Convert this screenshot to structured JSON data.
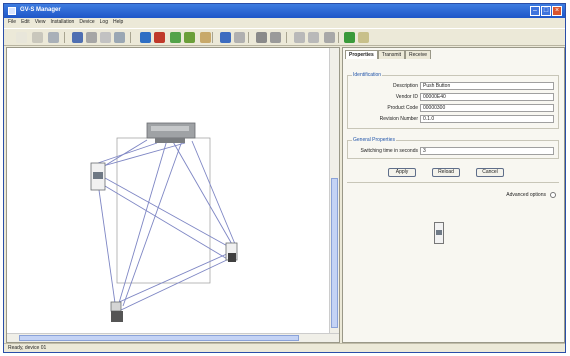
{
  "window": {
    "title": "GV-S Manager"
  },
  "menu": [
    "File",
    "Edit",
    "View",
    "Installation",
    "Device",
    "Log",
    "Help"
  ],
  "toolbar": {
    "buttons": [
      {
        "name": "new-icon",
        "color": "#e8e6da"
      },
      {
        "name": "open-icon",
        "color": "#c9c7bc"
      },
      {
        "name": "grid-icon",
        "color": "#a9b0b8"
      },
      {
        "name": "save-icon",
        "color": "#4f6fb2"
      },
      {
        "name": "print-icon",
        "color": "#a6a6a6"
      },
      {
        "name": "preview-icon",
        "color": "#c2c2c2"
      },
      {
        "name": "properties-icon",
        "color": "#9aa7b4"
      },
      {
        "name": "globe-icon",
        "color": "#2f6fc4"
      },
      {
        "name": "record-icon",
        "color": "#c0392b"
      },
      {
        "name": "link-icon",
        "color": "#53a34a"
      },
      {
        "name": "unlink-icon",
        "color": "#6b9f3a"
      },
      {
        "name": "forward-icon",
        "color": "#c8a96a"
      },
      {
        "name": "undo-icon",
        "color": "#3d6cc0"
      },
      {
        "name": "redo-icon",
        "color": "#b0b0b0"
      },
      {
        "name": "zoom-icon",
        "color": "#8a8a8a"
      },
      {
        "name": "fit-icon",
        "color": "#9a9a9a"
      },
      {
        "name": "layout-icon",
        "color": "#b9b9b9"
      },
      {
        "name": "tools-icon",
        "color": "#b9b9b9"
      },
      {
        "name": "config-icon",
        "color": "#a8a8a8"
      },
      {
        "name": "check-icon",
        "color": "#3a9a3a"
      },
      {
        "name": "exit-icon",
        "color": "#c8c08a"
      }
    ]
  },
  "diagram": {
    "line_color": "#7e86c4"
  },
  "tabs": [
    {
      "label": "Properties",
      "active": true
    },
    {
      "label": "Transmit",
      "active": false
    },
    {
      "label": "Receive",
      "active": false
    }
  ],
  "identification": {
    "title": "Identification",
    "fields": [
      {
        "label": "Description",
        "value": "Push Button"
      },
      {
        "label": "Vendor ID",
        "value": "00000E40"
      },
      {
        "label": "Product Code",
        "value": "00000300"
      },
      {
        "label": "Revision Number",
        "value": "0.1.0"
      }
    ]
  },
  "general": {
    "title": "General Properties",
    "fields": [
      {
        "label": "Switching time in seconds",
        "value": "3"
      }
    ]
  },
  "buttons": {
    "apply": "Apply",
    "reload": "Reload",
    "cancel": "Cancel"
  },
  "advanced": {
    "label": "Advanced options"
  },
  "status": {
    "text": "Ready, device 01"
  }
}
